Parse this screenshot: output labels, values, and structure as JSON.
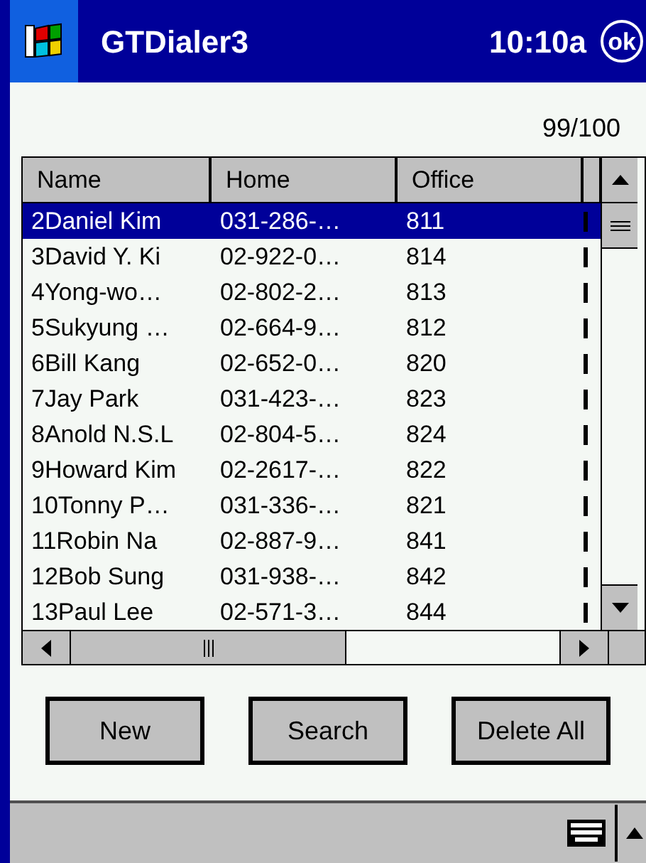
{
  "title_bar": {
    "title": "GTDialer3",
    "time": "10:10a",
    "ok": "ok"
  },
  "counter": "99/100",
  "table": {
    "columns": [
      "Name",
      "Home",
      "Office"
    ],
    "rows": [
      {
        "cells": [
          "2Daniel Kim",
          "031-286-…",
          "811"
        ],
        "selected": true
      },
      {
        "cells": [
          "3David Y. Ki",
          "02-922-0…",
          "814"
        ],
        "selected": false
      },
      {
        "cells": [
          "4Yong-wo…",
          "02-802-2…",
          "813"
        ],
        "selected": false
      },
      {
        "cells": [
          "5Sukyung …",
          "02-664-9…",
          "812"
        ],
        "selected": false
      },
      {
        "cells": [
          "6Bill Kang",
          "02-652-0…",
          "820"
        ],
        "selected": false
      },
      {
        "cells": [
          "7Jay Park",
          "031-423-…",
          "823"
        ],
        "selected": false
      },
      {
        "cells": [
          "8Anold N.S.L",
          "02-804-5…",
          "824"
        ],
        "selected": false
      },
      {
        "cells": [
          "9Howard Kim",
          "02-2617-…",
          "822"
        ],
        "selected": false
      },
      {
        "cells": [
          "10Tonny P…",
          "031-336-…",
          "821"
        ],
        "selected": false
      },
      {
        "cells": [
          "11Robin Na",
          "02-887-9…",
          "841"
        ],
        "selected": false
      },
      {
        "cells": [
          "12Bob Sung",
          "031-938-…",
          "842"
        ],
        "selected": false
      },
      {
        "cells": [
          "13Paul Lee",
          "02-571-3…",
          "844"
        ],
        "selected": false
      }
    ]
  },
  "buttons": [
    "New",
    "Search",
    "Delete All"
  ]
}
